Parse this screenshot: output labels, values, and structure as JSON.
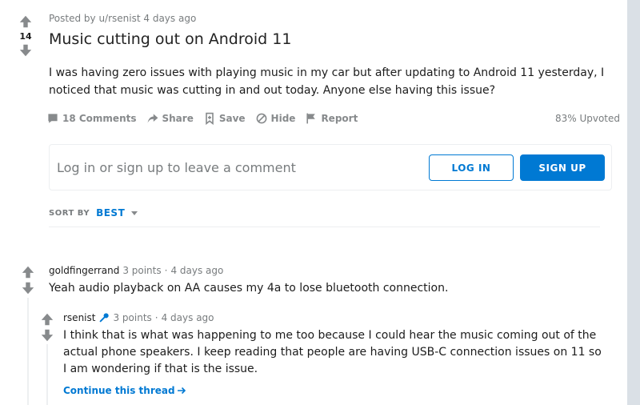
{
  "post": {
    "meta": "Posted by u/rsenist 4 days ago",
    "score": "14",
    "title": "Music cutting out on Android 11",
    "body": "I was having zero issues with playing music in my car but after updating to Android 11 yesterday, I noticed that music was cutting in and out today. Anyone else having this issue?",
    "actions": {
      "comments": "18 Comments",
      "share": "Share",
      "save": "Save",
      "hide": "Hide",
      "report": "Report"
    },
    "upvoted": "83% Upvoted"
  },
  "login_box": {
    "prompt": "Log in or sign up to leave a comment",
    "login_label": "LOG IN",
    "signup_label": "SIGN UP"
  },
  "sort": {
    "label": "SORT BY",
    "value": "BEST"
  },
  "comments": [
    {
      "author": "goldfingerrand",
      "points": "3 points",
      "sep": "·",
      "time": "4 days ago",
      "text": "Yeah audio playback on AA causes my 4a to lose bluetooth connection."
    },
    {
      "author": "rsenist",
      "points": "3 points",
      "sep": "·",
      "time": "4 days ago",
      "text": "I think that is what was happening to me too because I could hear the music coming out of the actual phone speakers. I keep reading that people are having USB-C connection issues on 11 so I am wondering if that is the issue."
    }
  ],
  "continue_thread": "Continue this thread",
  "colors": {
    "accent": "#0079d3",
    "muted": "#878a8c",
    "background": "#dae0e6"
  }
}
